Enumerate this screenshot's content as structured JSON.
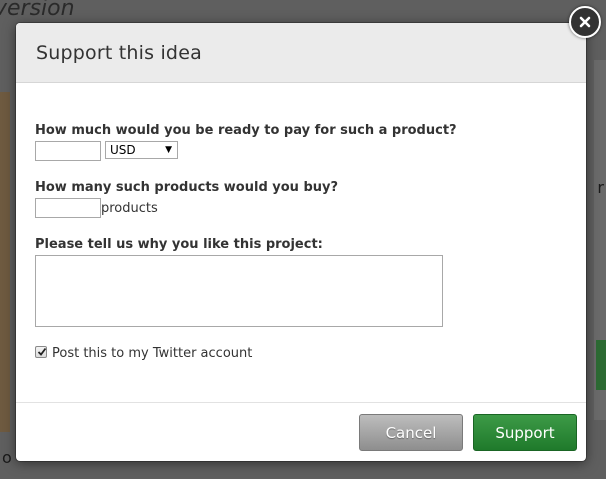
{
  "background": {
    "title_fragment": "version",
    "left_fragment": "o",
    "right_fragment": "r"
  },
  "modal": {
    "title": "Support this idea",
    "close_icon": "close-icon"
  },
  "form": {
    "price_label": "How much would you be ready to pay for such a product?",
    "price_value": "",
    "currency": {
      "selected": "USD"
    },
    "quantity_label": "How many such products would you buy?",
    "quantity_value": "",
    "quantity_unit": "products",
    "reason_label": "Please tell us why you like this project:",
    "reason_value": "",
    "twitter": {
      "label": "Post this to my Twitter account",
      "checked": true
    }
  },
  "footer": {
    "cancel_label": "Cancel",
    "support_label": "Support"
  },
  "colors": {
    "accent_green": "#2a8a36",
    "cancel_gray": "#a5a5a5",
    "header_gray": "#ebebeb"
  }
}
